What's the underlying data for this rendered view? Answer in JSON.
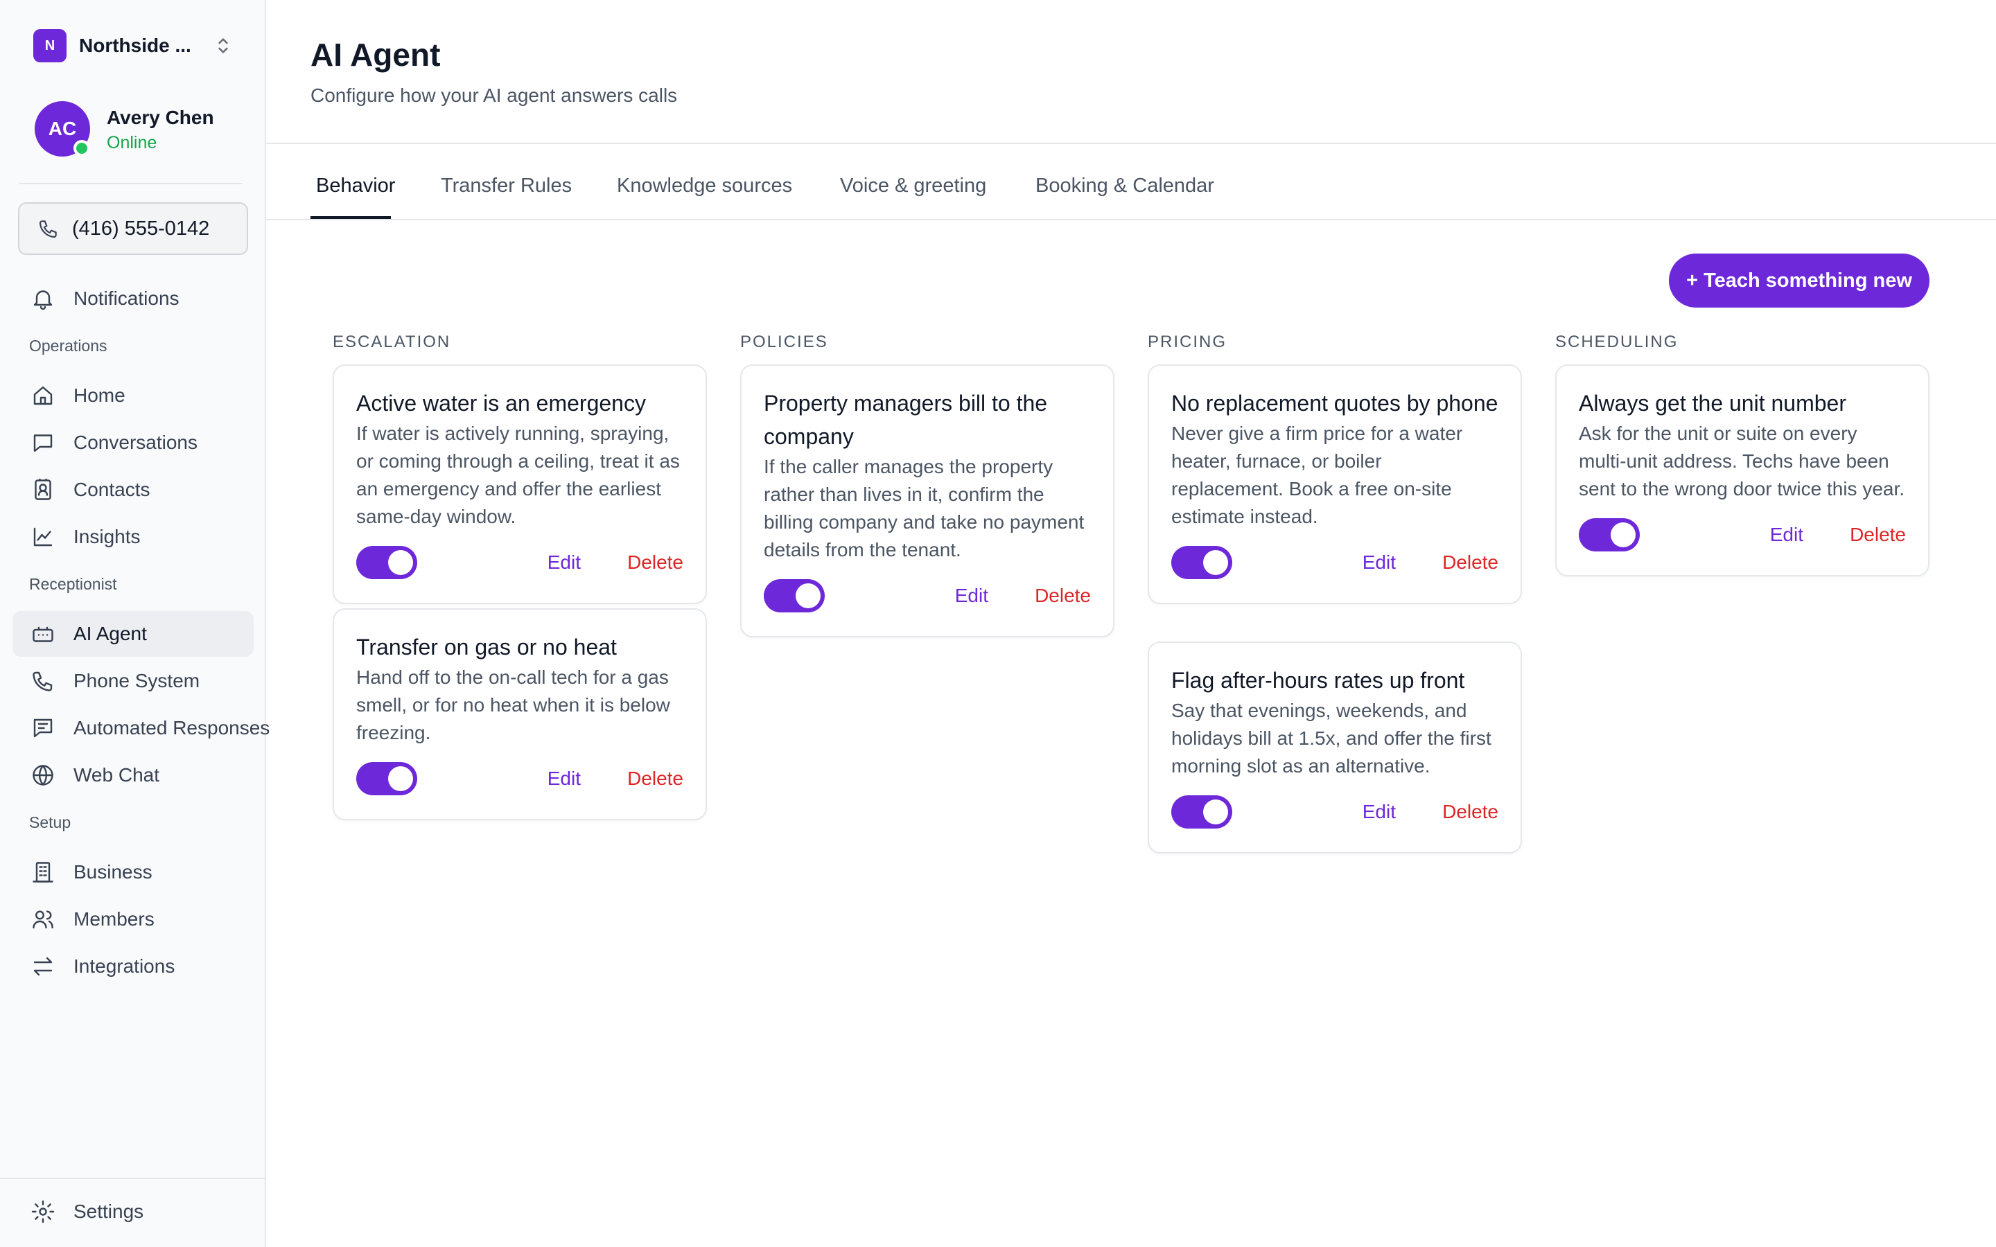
{
  "workspace": {
    "initial": "N",
    "name": "Northside ..."
  },
  "user": {
    "initials": "AC",
    "name": "Avery Chen",
    "status": "Online"
  },
  "phone": {
    "number": "(416) 555-0142"
  },
  "nav": {
    "notifications": "Notifications",
    "sections": {
      "operations": "Operations",
      "receptionist": "Receptionist",
      "setup": "Setup"
    },
    "home": "Home",
    "conversations": "Conversations",
    "contacts": "Contacts",
    "insights": "Insights",
    "ai_agent": "AI Agent",
    "phone_system": "Phone System",
    "automated_responses": "Automated Responses",
    "web_chat": "Web Chat",
    "business": "Business",
    "members": "Members",
    "integrations": "Integrations",
    "settings": "Settings"
  },
  "header": {
    "title": "AI Agent",
    "subtitle": "Configure how your AI agent answers calls"
  },
  "tabs": [
    "Behavior",
    "Transfer Rules",
    "Knowledge sources",
    "Voice & greeting",
    "Booking & Calendar"
  ],
  "active_tab": "Behavior",
  "teach_button": "+ Teach something new",
  "actions": {
    "edit": "Edit",
    "delete": "Delete"
  },
  "columns": [
    {
      "heading": "ESCALATION",
      "cards": [
        {
          "title": "Active water is an emergency",
          "description": "If water is actively running, spraying, or coming through a ceiling, treat it as an emergency and offer the earliest same-day window.",
          "enabled": true
        },
        {
          "title": "Transfer on gas or no heat",
          "description": "Hand off to the on-call tech for a gas smell, or for no heat when it is below freezing.",
          "enabled": true
        }
      ]
    },
    {
      "heading": "POLICIES",
      "cards": [
        {
          "title": "Property managers bill to the company",
          "description": "If the caller manages the property rather than lives in it, confirm the billing company and take no payment details from the tenant.",
          "enabled": true
        }
      ]
    },
    {
      "heading": "PRICING",
      "cards": [
        {
          "title": "No replacement quotes by phone",
          "description": "Never give a firm price for a water heater, furnace, or boiler replacement. Book a free on-site estimate instead.",
          "enabled": true
        },
        {
          "title": "Flag after-hours rates up front",
          "description": "Say that evenings, weekends, and holidays bill at 1.5x, and offer the first morning slot as an alternative.",
          "enabled": true
        }
      ]
    },
    {
      "heading": "SCHEDULING",
      "cards": [
        {
          "title": "Always get the unit number",
          "description": "Ask for the unit or suite on every multi-unit address. Techs have been sent to the wrong door twice this year.",
          "enabled": true
        }
      ]
    }
  ],
  "colors": {
    "accent": "#6d28d9",
    "danger": "#dc2626",
    "online": "#22c55e"
  }
}
